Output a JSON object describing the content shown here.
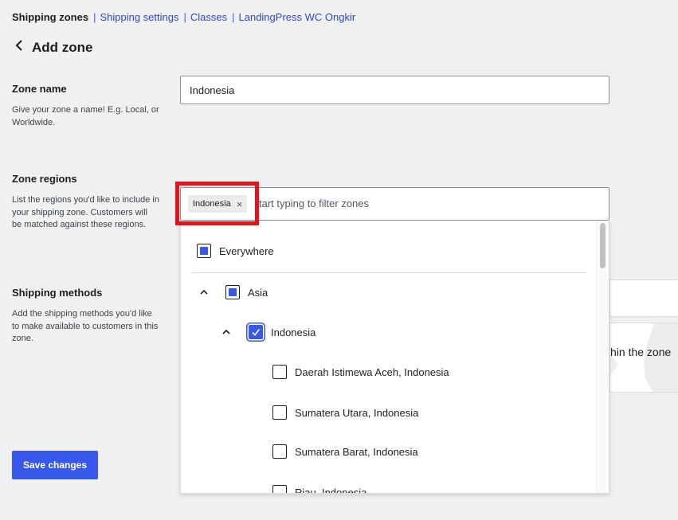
{
  "nav": {
    "current": "Shipping zones",
    "separator": "|",
    "links": [
      "Shipping settings",
      "Classes",
      "LandingPress WC Ongkir"
    ]
  },
  "header": {
    "back_icon": "chevron-left-icon",
    "title": "Add zone"
  },
  "zone_name": {
    "title": "Zone name",
    "description": "Give your zone a name! E.g. Local, or Worldwide.",
    "value": "Indonesia"
  },
  "zone_regions": {
    "title": "Zone regions",
    "description": "List the regions you'd like to include in your shipping zone. Customers will be matched against these regions.",
    "placeholder": "Start typing to filter zones",
    "placeholder_visible": "tart typing to filter zones",
    "chip": {
      "label": "Indonesia",
      "remove_glyph": "×"
    },
    "dropdown": {
      "options": [
        {
          "label": "Everywhere",
          "state": "partial"
        },
        {
          "label": "Asia",
          "state": "partial",
          "toggle_icon": "chevron-up-icon"
        },
        {
          "label": "Indonesia",
          "state": "checked",
          "toggle_icon": "chevron-up-icon"
        },
        {
          "label": "Daerah Istimewa Aceh, Indonesia",
          "state": "unchecked"
        },
        {
          "label": "Sumatera Utara, Indonesia",
          "state": "unchecked"
        },
        {
          "label": "Sumatera Barat, Indonesia",
          "state": "unchecked"
        },
        {
          "label": "Riau, Indonesia",
          "state": "unchecked"
        }
      ]
    }
  },
  "shipping_methods": {
    "title": "Shipping methods",
    "description": "Add the shipping methods you'd like to make available to customers in this zone.",
    "partial_text": "hin the zone"
  },
  "footer": {
    "save_label": "Save changes"
  },
  "colors": {
    "accent": "#3858e9",
    "highlight": "#e5131c",
    "background": "#f0f0f1"
  }
}
